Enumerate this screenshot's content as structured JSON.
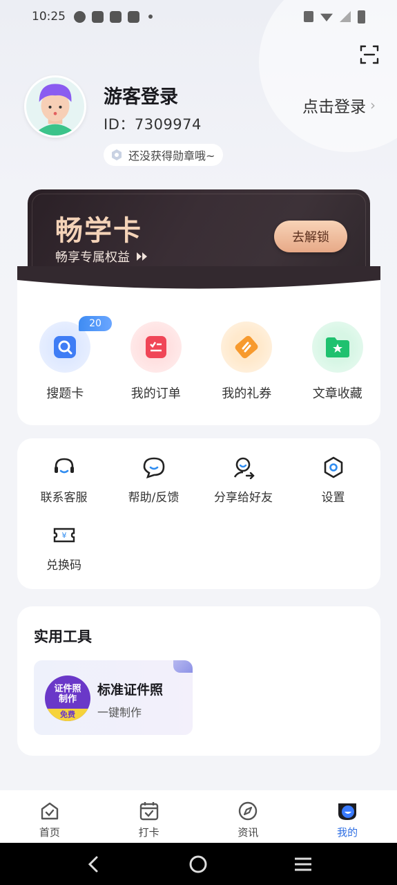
{
  "status_bar": {
    "time": "10:25"
  },
  "profile": {
    "name": "游客登录",
    "id_text": "ID：7309974",
    "login_link": "点击登录",
    "badge_text": "还没获得勋章哦~"
  },
  "vip_card": {
    "title": "畅学卡",
    "subtitle": "畅享专属权益",
    "button": "去解锁"
  },
  "quick_actions": [
    {
      "label": "搜题卡",
      "icon": "search-card-icon",
      "badge": "20"
    },
    {
      "label": "我的订单",
      "icon": "order-icon"
    },
    {
      "label": "我的礼券",
      "icon": "coupon-icon"
    },
    {
      "label": "文章收藏",
      "icon": "favorites-folder-icon"
    }
  ],
  "services": [
    {
      "label": "联系客服",
      "icon": "headset-icon"
    },
    {
      "label": "帮助/反馈",
      "icon": "chat-bubble-icon"
    },
    {
      "label": "分享给好友",
      "icon": "share-user-icon"
    },
    {
      "label": "设置",
      "icon": "settings-hex-icon"
    },
    {
      "label": "兑换码",
      "icon": "redeem-ticket-icon"
    }
  ],
  "tools": {
    "title": "实用工具",
    "items": [
      {
        "name": "标准证件照",
        "desc": "一键制作",
        "logo_line1": "证件照",
        "logo_line2": "制作",
        "logo_tag": "免费"
      }
    ]
  },
  "tabbar": [
    {
      "label": "首页",
      "icon": "home-icon"
    },
    {
      "label": "打卡",
      "icon": "calendar-check-icon"
    },
    {
      "label": "资讯",
      "icon": "compass-icon"
    },
    {
      "label": "我的",
      "icon": "profile-icon",
      "active": true
    }
  ],
  "colors": {
    "accent": "#2f6fe3",
    "vip_gold": "#f4d3b8",
    "badge_blue": "#3f8cf3"
  }
}
